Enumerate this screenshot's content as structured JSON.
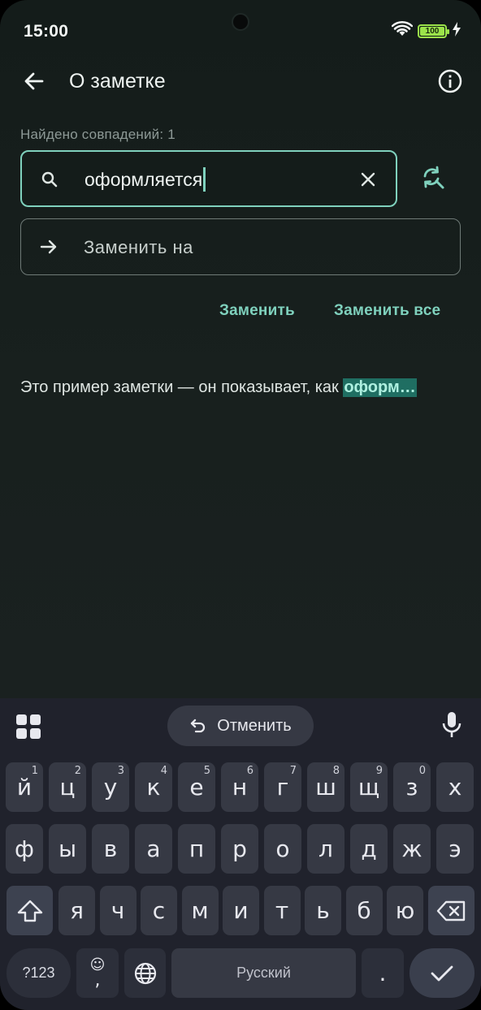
{
  "status": {
    "time": "15:00",
    "battery": "100"
  },
  "appbar": {
    "title": "О заметке"
  },
  "find": {
    "match_count": "Найдено совпадений: 1",
    "query": "оформляется",
    "replace_placeholder": "Заменить на",
    "replace_label": "Заменить",
    "replace_all_label": "Заменить все"
  },
  "note": {
    "text_before": "Это пример заметки — он показывает, как ",
    "text_match": "оформ…"
  },
  "colors": {
    "accent": "#7fd1bd",
    "highlight_bg": "#1f6e62",
    "keyboard_bg": "#20222c",
    "key_bg": "#363944"
  },
  "keyboard": {
    "undo_label": "Отменить",
    "row1": [
      {
        "k": "й",
        "h": "1"
      },
      {
        "k": "ц",
        "h": "2"
      },
      {
        "k": "у",
        "h": "3"
      },
      {
        "k": "к",
        "h": "4"
      },
      {
        "k": "е",
        "h": "5"
      },
      {
        "k": "н",
        "h": "6"
      },
      {
        "k": "г",
        "h": "7"
      },
      {
        "k": "ш",
        "h": "8"
      },
      {
        "k": "щ",
        "h": "9"
      },
      {
        "k": "з",
        "h": "0"
      },
      {
        "k": "х",
        "h": ""
      }
    ],
    "row2": [
      "ф",
      "ы",
      "в",
      "а",
      "п",
      "р",
      "о",
      "л",
      "д",
      "ж",
      "э"
    ],
    "row3": [
      "я",
      "ч",
      "с",
      "м",
      "и",
      "т",
      "ь",
      "б",
      "ю"
    ],
    "symbols_label": "?123",
    "emoji_label": "☺",
    "comma_label": ",",
    "space_label": "Русский",
    "period_label": "."
  }
}
